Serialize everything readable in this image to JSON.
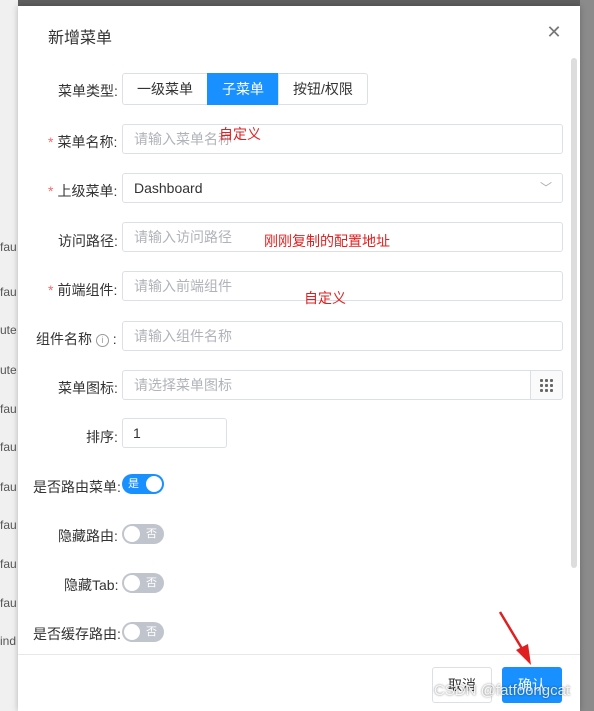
{
  "background": {
    "side_items": [
      "fau",
      "fau",
      "ute",
      "ute",
      "fau",
      "fau",
      "fau",
      "fau",
      "fau",
      "fau",
      "ind"
    ]
  },
  "dialog": {
    "title": "新增菜单",
    "close_glyph": "✕"
  },
  "form": {
    "menu_type": {
      "label": "菜单类型:",
      "options": [
        "一级菜单",
        "子菜单",
        "按钮/权限"
      ],
      "selected": "子菜单"
    },
    "menu_name": {
      "label": "菜单名称:",
      "placeholder": "请输入菜单名称",
      "required": true
    },
    "parent_menu": {
      "label": "上级菜单:",
      "value": "Dashboard",
      "required": true
    },
    "path": {
      "label": "访问路径:",
      "placeholder": "请输入访问路径"
    },
    "component": {
      "label": "前端组件:",
      "placeholder": "请输入前端组件",
      "required": true
    },
    "component_name": {
      "label": "组件名称",
      "placeholder": "请输入组件名称"
    },
    "menu_icon": {
      "label": "菜单图标:",
      "placeholder": "请选择菜单图标"
    },
    "sort": {
      "label": "排序:",
      "value": "1"
    },
    "is_route": {
      "label": "是否路由菜单:",
      "on": true,
      "text": "是"
    },
    "hide_route": {
      "label": "隐藏路由:",
      "on": false,
      "text": "否"
    },
    "hide_tab": {
      "label": "隐藏Tab:",
      "on": false,
      "text": "否"
    },
    "keep_alive": {
      "label": "是否缓存路由:",
      "on": false,
      "text": "否"
    }
  },
  "annotations": {
    "name_note": "自定义",
    "path_note": "刚刚复制的配置地址",
    "component_note": "自定义"
  },
  "footer": {
    "cancel": "取消",
    "ok": "确认"
  },
  "watermark": "CSDN @fatfoongcat",
  "colors": {
    "primary": "#1890ff",
    "annotation": "#e02020",
    "required": "#f56c6c"
  }
}
